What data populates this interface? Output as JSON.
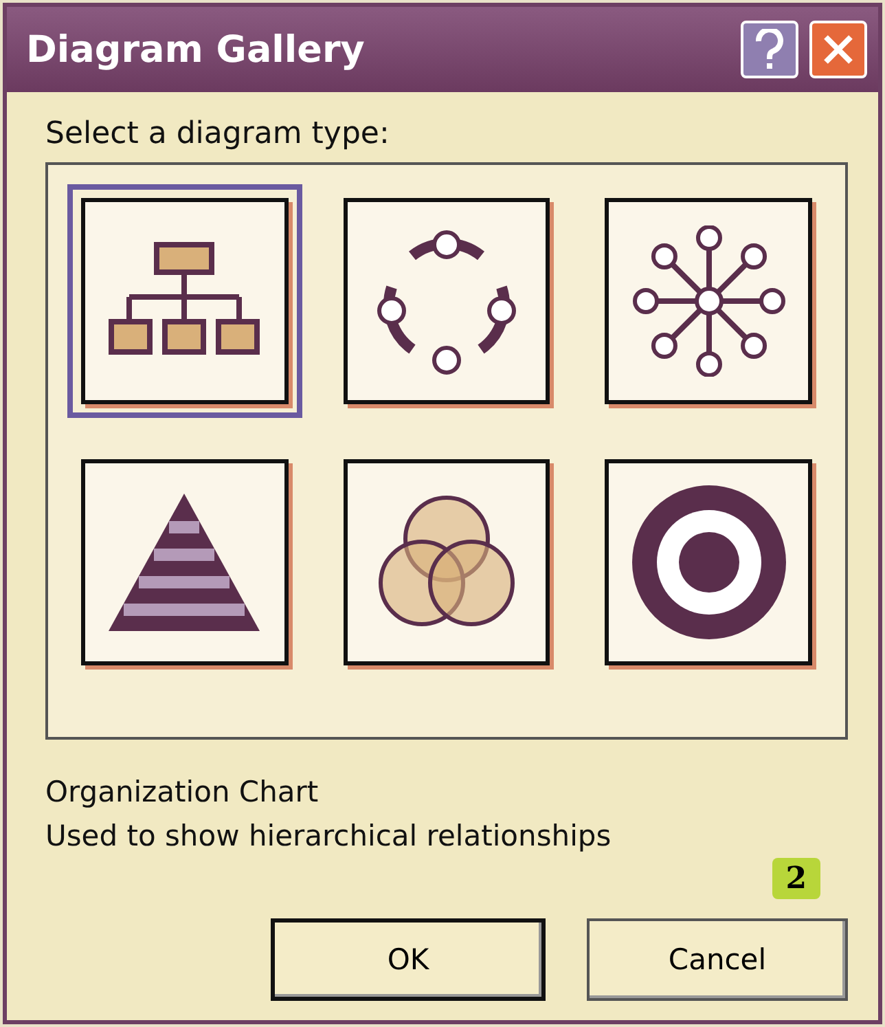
{
  "window": {
    "title": "Diagram Gallery"
  },
  "prompt": "Select a diagram type:",
  "diagrams": [
    {
      "kind": "org",
      "selected": true
    },
    {
      "kind": "cycle",
      "selected": false
    },
    {
      "kind": "radial",
      "selected": false
    },
    {
      "kind": "pyramid",
      "selected": false
    },
    {
      "kind": "venn",
      "selected": false
    },
    {
      "kind": "target",
      "selected": false
    }
  ],
  "description": {
    "name": "Organization Chart",
    "text": "Used to show hierarchical relationships"
  },
  "callout": "2",
  "buttons": [
    {
      "label": "OK",
      "default": true
    },
    {
      "label": "Cancel",
      "default": false
    }
  ]
}
